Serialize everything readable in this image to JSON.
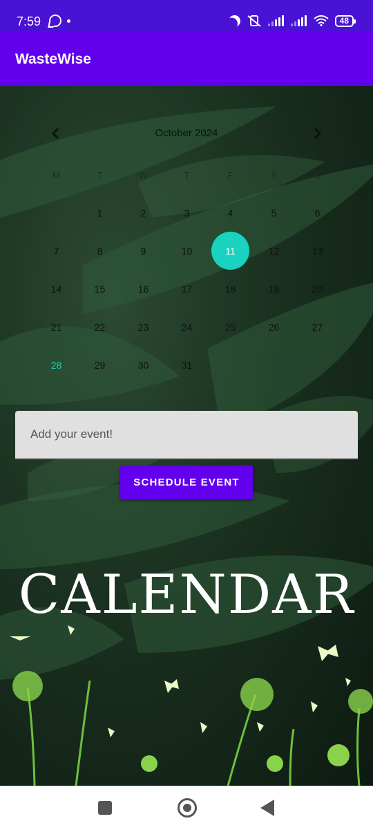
{
  "status_bar": {
    "time": "7:59",
    "battery": "48",
    "icons": [
      "whatsapp-icon",
      "notification-dot-icon",
      "moon-icon",
      "vibrate-off-icon",
      "signal-icon",
      "signal-icon",
      "wifi-icon",
      "battery-icon"
    ]
  },
  "app_bar": {
    "title": "WasteWise"
  },
  "calendar": {
    "month_label": "October 2024",
    "prev_icon": "chevron-left-icon",
    "next_icon": "chevron-right-icon",
    "weekdays": [
      "M",
      "T",
      "W",
      "T",
      "F",
      "S",
      "S"
    ],
    "first_day_offset": 1,
    "days": [
      "1",
      "2",
      "3",
      "4",
      "5",
      "6",
      "7",
      "8",
      "9",
      "10",
      "11",
      "12",
      "13",
      "14",
      "15",
      "16",
      "17",
      "18",
      "19",
      "20",
      "21",
      "22",
      "23",
      "24",
      "25",
      "26",
      "27",
      "28",
      "29",
      "30",
      "31"
    ],
    "selected_day": "11",
    "highlighted_day": "28",
    "selected_color": "#19d3c0"
  },
  "event": {
    "placeholder": "Add your event!",
    "value": "",
    "button_label": "SCHEDULE EVENT"
  },
  "artwork": {
    "title": "CALENDAR"
  },
  "colors": {
    "status_bar": "#4a12d4",
    "primary": "#6200ee",
    "accent": "#19d3c0"
  },
  "nav_bar": {
    "icons": [
      "recent-apps-icon",
      "home-icon",
      "back-icon"
    ]
  }
}
